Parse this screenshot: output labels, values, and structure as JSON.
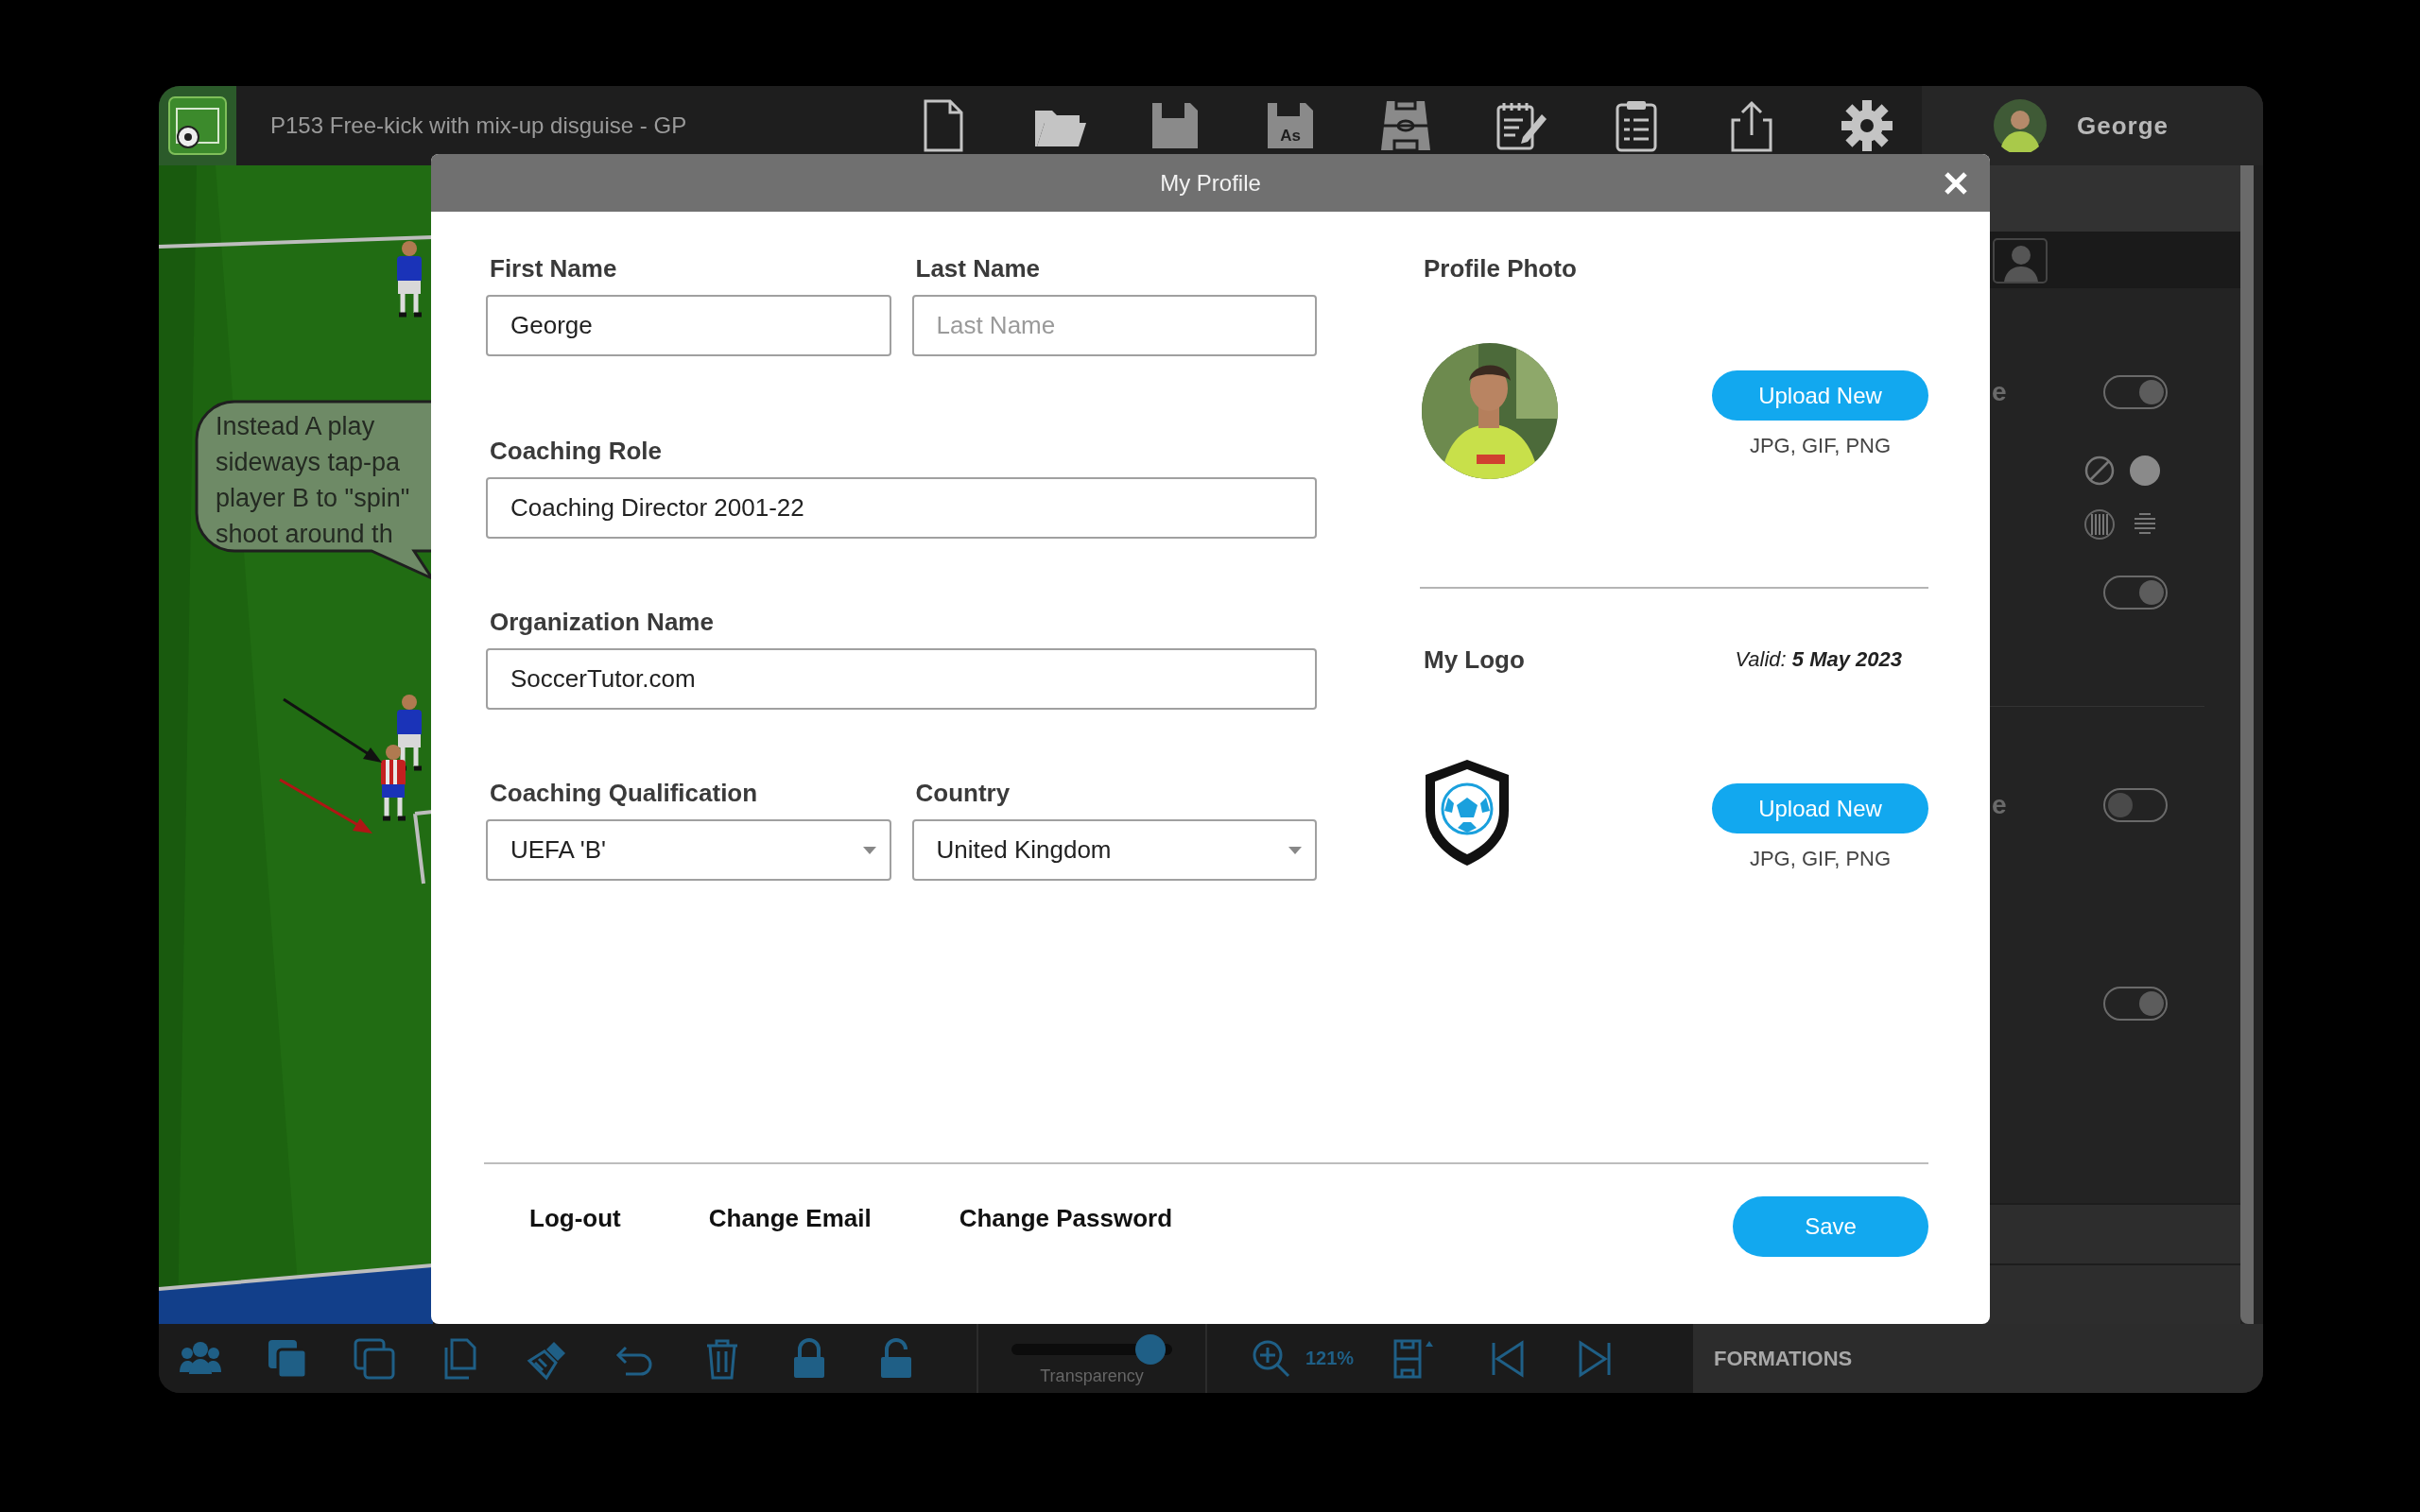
{
  "app": {
    "title": "P153 Free-kick with mix-up disguise - GP",
    "save_as_label": "As",
    "user_name": "George"
  },
  "canvas": {
    "bubble_lines": [
      "Instead A play",
      "sideways tap-pa",
      "player B to \"spin\"",
      "shoot around th"
    ]
  },
  "side_panel": {
    "label_fragments": [
      "e",
      "e"
    ],
    "toggles": [
      {
        "on": true
      },
      {
        "on": true
      },
      {
        "on": false
      },
      {
        "on": true
      }
    ]
  },
  "bottom_bar": {
    "transparency": {
      "label": "Transparency",
      "level": 0.95
    },
    "zoom": "121%",
    "section": "FORMATIONS"
  },
  "dialog": {
    "title": "My Profile",
    "rows": [
      [
        {
          "kind": "text",
          "label": "First Name",
          "value": "George"
        },
        {
          "kind": "text",
          "label": "Last Name",
          "placeholder": "Last Name"
        }
      ],
      [
        {
          "kind": "text",
          "label": "Coaching Role",
          "value": "Coaching Director 2001-22"
        }
      ],
      [
        {
          "kind": "text",
          "label": "Organization Name",
          "value": "SoccerTutor.com"
        }
      ],
      [
        {
          "kind": "select",
          "label": "Coaching Qualification",
          "value": "UEFA 'B'"
        },
        {
          "kind": "select",
          "label": "Country",
          "value": "United Kingdom"
        }
      ]
    ],
    "profile_photo": {
      "label": "Profile Photo",
      "button": "Upload New",
      "formats": "JPG, GIF, PNG"
    },
    "logo": {
      "label": "My Logo",
      "validity": "Valid: **5 May 2023**",
      "button": "Upload New",
      "formats": "JPG, GIF, PNG"
    },
    "links": [
      "Log-out",
      "Change Email",
      "Change Password"
    ],
    "save": "Save"
  }
}
